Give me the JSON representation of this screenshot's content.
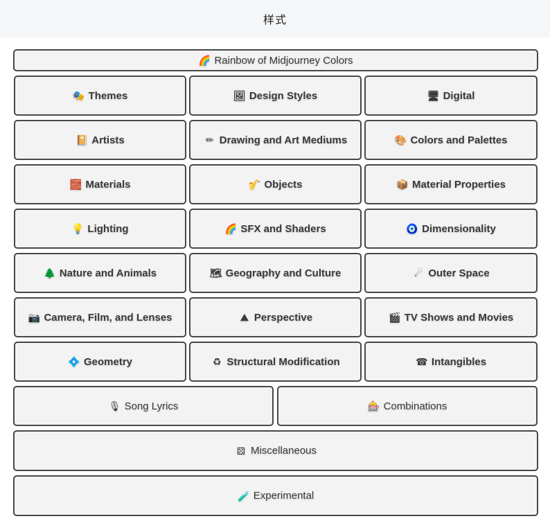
{
  "header": {
    "title": "样式"
  },
  "banner": {
    "label": "Rainbow of Midjourney Colors",
    "icon": "rainbow-icon",
    "glyph": "🌈"
  },
  "grid": [
    {
      "label": "Themes",
      "icon": "performing-arts-icon",
      "glyph": "🎭"
    },
    {
      "label": "Design Styles",
      "icon": "framed-picture-icon",
      "glyph": "🖼"
    },
    {
      "label": "Digital",
      "icon": "desktop-computer-icon",
      "glyph": "🖥"
    },
    {
      "label": "Artists",
      "icon": "notebook-icon",
      "glyph": "📔"
    },
    {
      "label": "Drawing and Art Mediums",
      "icon": "pencil-icon",
      "glyph": "✏"
    },
    {
      "label": "Colors and Palettes",
      "icon": "artist-palette-icon",
      "glyph": "🎨"
    },
    {
      "label": "Materials",
      "icon": "bricks-icon",
      "glyph": "🧱"
    },
    {
      "label": "Objects",
      "icon": "saxophone-icon",
      "glyph": "🎷"
    },
    {
      "label": "Material Properties",
      "icon": "package-icon",
      "glyph": "📦"
    },
    {
      "label": "Lighting",
      "icon": "light-bulb-icon",
      "glyph": "💡"
    },
    {
      "label": "SFX and Shaders",
      "icon": "rainbow-icon",
      "glyph": "🌈"
    },
    {
      "label": "Dimensionality",
      "icon": "nazar-amulet-icon",
      "glyph": "🧿"
    },
    {
      "label": "Nature and Animals",
      "icon": "evergreen-tree-icon",
      "glyph": "🌲"
    },
    {
      "label": "Geography and Culture",
      "icon": "world-map-icon",
      "glyph": "🗺"
    },
    {
      "label": "Outer Space",
      "icon": "comet-icon",
      "glyph": "☄"
    },
    {
      "label": "Camera, Film, and Lenses",
      "icon": "camera-icon",
      "glyph": "📷"
    },
    {
      "label": "Perspective",
      "icon": "mountain-icon",
      "glyph": "⛰"
    },
    {
      "label": "TV Shows and Movies",
      "icon": "clapper-board-icon",
      "glyph": "🎬"
    },
    {
      "label": "Geometry",
      "icon": "diamond-with-dot-icon",
      "glyph": "💠"
    },
    {
      "label": "Structural Modification",
      "icon": "recycling-icon",
      "glyph": "♻"
    },
    {
      "label": "Intangibles",
      "icon": "telephone-icon",
      "glyph": "☎"
    }
  ],
  "pair": [
    {
      "label": "Song Lyrics",
      "icon": "microphone-icon",
      "glyph": "🎙"
    },
    {
      "label": "Combinations",
      "icon": "slot-machine-icon",
      "glyph": "🎰"
    }
  ],
  "wide": [
    {
      "label": "Miscellaneous",
      "icon": "dice-icon",
      "glyph": "⚄"
    },
    {
      "label": "Experimental",
      "icon": "test-tube-icon",
      "glyph": "🧪"
    }
  ]
}
